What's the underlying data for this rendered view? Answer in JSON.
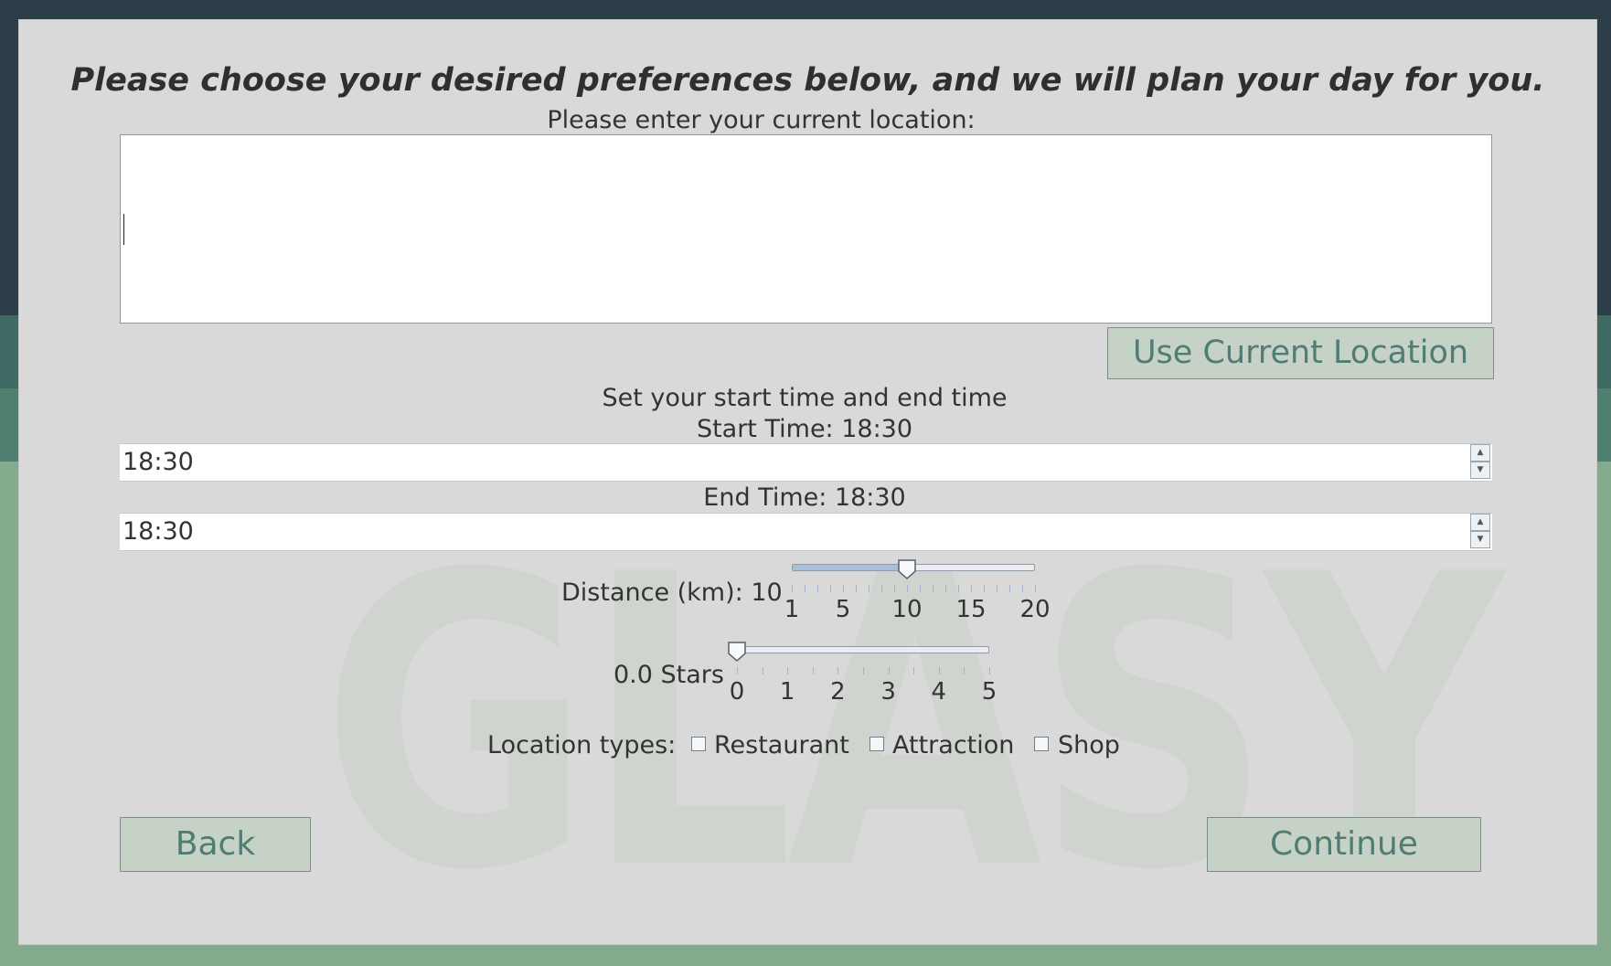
{
  "form": {
    "title": "Please choose your desired preferences below, and we will plan your day for you.",
    "location_label": "Please enter your current location:",
    "location_value": "",
    "use_location_button": "Use Current Location",
    "time_section_label": "Set your start time and end time",
    "start_time_label": "Start Time: 18:30",
    "start_time_value": "18:30",
    "end_time_label": "End Time: 18:30",
    "end_time_value": "18:30"
  },
  "distance": {
    "label": "Distance (km): 10",
    "value": 10,
    "min": 1,
    "max": 20,
    "tick_labels": [
      "1",
      "5",
      "10",
      "15",
      "20"
    ]
  },
  "rating": {
    "label": "0.0 Stars",
    "value": 0,
    "min": 0,
    "max": 5,
    "tick_labels": [
      "0",
      "1",
      "2",
      "3",
      "4",
      "5"
    ]
  },
  "location_types": {
    "label": "Location types:",
    "options": [
      {
        "label": "Restaurant",
        "checked": false
      },
      {
        "label": "Attraction",
        "checked": false
      },
      {
        "label": "Shop",
        "checked": false
      }
    ]
  },
  "nav": {
    "back_label": "Back",
    "continue_label": "Continue"
  },
  "watermark_text": "GLASY",
  "colors": {
    "backdrop_dark": "#2c3f48",
    "backdrop_green": "#84ab8d",
    "panel": "#d9d9d9",
    "button_fill": "#c6d2c6",
    "button_text": "#4f7d74",
    "slider_fill": "#a9bfd6"
  }
}
